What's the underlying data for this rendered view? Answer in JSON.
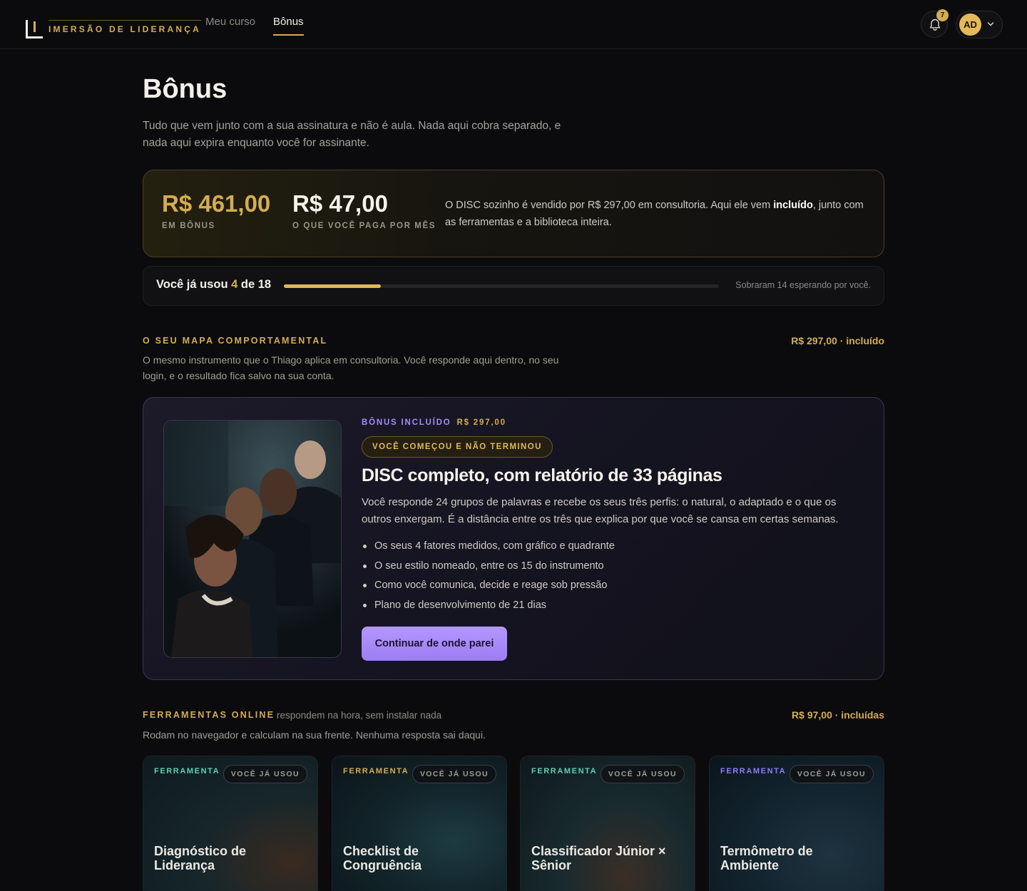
{
  "header": {
    "logo_text": "IMERSÃO DE LIDERANÇA",
    "nav": [
      {
        "label": "Meu curso",
        "active": false
      },
      {
        "label": "Bônus",
        "active": true
      }
    ],
    "notification_count": "7",
    "user_initials": "AD"
  },
  "page": {
    "title": "Bônus",
    "subtitle": "Tudo que vem junto com a sua assinatura e não é aula. Nada aqui cobra separado, e nada aqui expira enquanto você for assinante."
  },
  "value_card": {
    "bonus_amount": "R$ 461,00",
    "bonus_label": "EM BÔNUS",
    "monthly_amount": "R$ 47,00",
    "monthly_label": "O QUE VOCÊ PAGA POR MÊS",
    "desc_before": "O DISC sozinho é vendido por R$ 297,00 em consultoria. Aqui ele vem ",
    "desc_bold": "incluído",
    "desc_after": ", junto com as ferramentas e a biblioteca inteira."
  },
  "progress": {
    "prefix": "Você já usou ",
    "used": "4",
    "suffix": " de 18",
    "used_count": 4,
    "total_count": 18,
    "remaining_text": "Sobraram 14 esperando por você."
  },
  "section_map": {
    "title": "O SEU MAPA COMPORTAMENTAL",
    "price": "R$ 297,00 · incluído",
    "description": "O mesmo instrumento que o Thiago aplica em consultoria. Você responde aqui dentro, no seu login, e o resultado fica salvo na sua conta."
  },
  "disc_card": {
    "kicker": "BÔNUS INCLUÍDO",
    "kicker_price": "R$ 297,00",
    "status": "VOCÊ COMEÇOU E NÃO TERMINOU",
    "title": "DISC completo, com relatório de 33 páginas",
    "description": "Você responde 24 grupos de palavras e recebe os seus três perfis: o natural, o adaptado e o que os outros enxergam. É a distância entre os três que explica por que você se cansa em certas semanas.",
    "bullets": [
      "Os seus 4 fatores medidos, com gráfico e quadrante",
      "O seu estilo nomeado, entre os 15 do instrumento",
      "Como você comunica, decide e reage sob pressão",
      "Plano de desenvolvimento de 21 dias"
    ],
    "button": "Continuar de onde parei"
  },
  "section_tools": {
    "title": "FERRAMENTAS ONLINE",
    "aside": "respondem na hora, sem instalar nada",
    "price": "R$ 97,00 · incluídas",
    "description": "Rodam no navegador e calculam na sua frente. Nenhuma resposta sai daqui."
  },
  "tools": [
    {
      "kicker": "FERRAMENTA",
      "badge": "VOCÊ JÁ USOU",
      "name": "Diagnóstico de Liderança",
      "accent": "#5fd0b0"
    },
    {
      "kicker": "FERRAMENTA",
      "badge": "VOCÊ JÁ USOU",
      "name": "Checklist de Congruência",
      "accent": "#d4ad52"
    },
    {
      "kicker": "FERRAMENTA",
      "badge": "VOCÊ JÁ USOU",
      "name": "Classificador Júnior × Sênior",
      "accent": "#5fd0b0"
    },
    {
      "kicker": "FERRAMENTA",
      "badge": "VOCÊ JÁ USOU",
      "name": "Termômetro de Ambiente",
      "accent": "#8b7cf6"
    }
  ],
  "colors": {
    "background": "#0b0b0d",
    "gold": "#d4ad52",
    "purple": "#a78bfa",
    "teal": "#5fd0b0"
  }
}
